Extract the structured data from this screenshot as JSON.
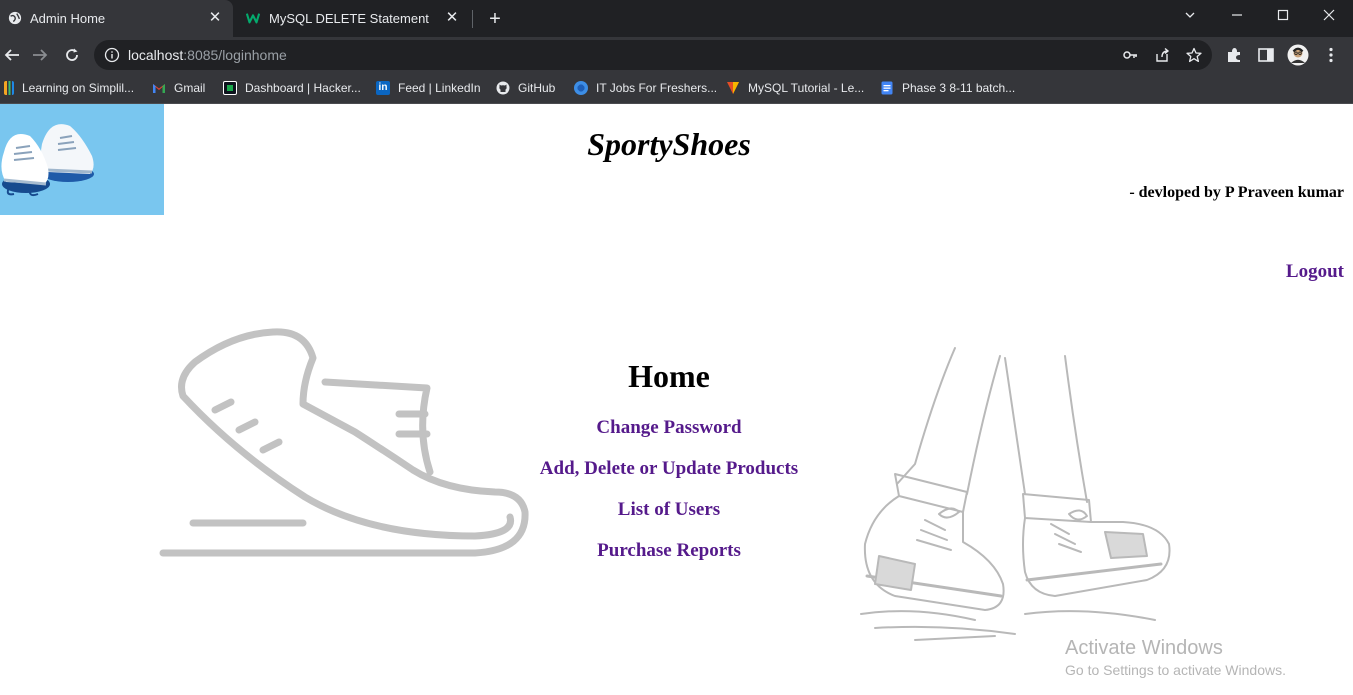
{
  "browser": {
    "tabs": [
      {
        "title": "Admin Home",
        "icon": "globe-icon",
        "active": true
      },
      {
        "title": "MySQL DELETE Statement",
        "icon": "w3schools-icon",
        "active": false
      }
    ],
    "url": {
      "host": "localhost",
      "path": ":8085/loginhome"
    },
    "bookmarks": [
      {
        "label": "Learning on Simplil...",
        "icon": "simplilearn-icon",
        "color": "#f5a623"
      },
      {
        "label": "Gmail",
        "icon": "gmail-icon",
        "color": "#ea4335"
      },
      {
        "label": "Dashboard | Hacker...",
        "icon": "hackerrank-icon",
        "color": "#1ba94c"
      },
      {
        "label": "Feed | LinkedIn",
        "icon": "linkedin-icon",
        "color": "#0a66c2"
      },
      {
        "label": "GitHub",
        "icon": "github-icon",
        "color": "#ffffff"
      },
      {
        "label": "IT Jobs For Freshers...",
        "icon": "jobs-icon",
        "color": "#3d8ee6"
      },
      {
        "label": "MySQL Tutorial - Le...",
        "icon": "mysql-icon",
        "color": "#e44d26"
      },
      {
        "label": "Phase 3 8-11 batch...",
        "icon": "docs-icon",
        "color": "#4285f4"
      }
    ]
  },
  "header": {
    "brand": "SportyShoes",
    "byline": "- devloped by P Praveen kumar",
    "logout": "Logout"
  },
  "main": {
    "title": "Home",
    "links": [
      "Change Password",
      "Add, Delete or Update Products",
      "List of Users",
      "Purchase Reports"
    ]
  },
  "watermark": {
    "title": "Activate Windows",
    "subtitle": "Go to Settings to activate Windows."
  },
  "colors": {
    "link": "#551a8b",
    "logo_bg": "#79c6ef",
    "chrome_dark": "#202124",
    "chrome_mid": "#35363a"
  }
}
